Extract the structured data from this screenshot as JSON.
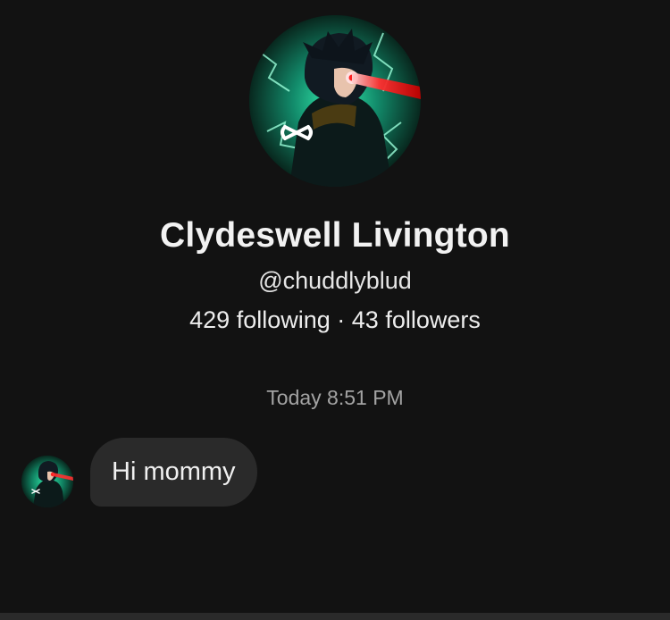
{
  "profile": {
    "display_name": "Clydeswell Livington",
    "username": "@chuddlyblud",
    "following_count": "429",
    "following_label": "following",
    "separator": "·",
    "followers_count": "43",
    "followers_label": "followers"
  },
  "conversation": {
    "timestamp": "Today 8:51 PM",
    "messages": [
      {
        "text": "Hi mommy"
      }
    ]
  },
  "colors": {
    "background": "#121212",
    "bubble": "#2a2a2a",
    "avatar_glow": "#2fe3a1"
  },
  "icons": {
    "profile_avatar": "anime-avatar-icon",
    "message_avatar": "anime-avatar-icon"
  }
}
